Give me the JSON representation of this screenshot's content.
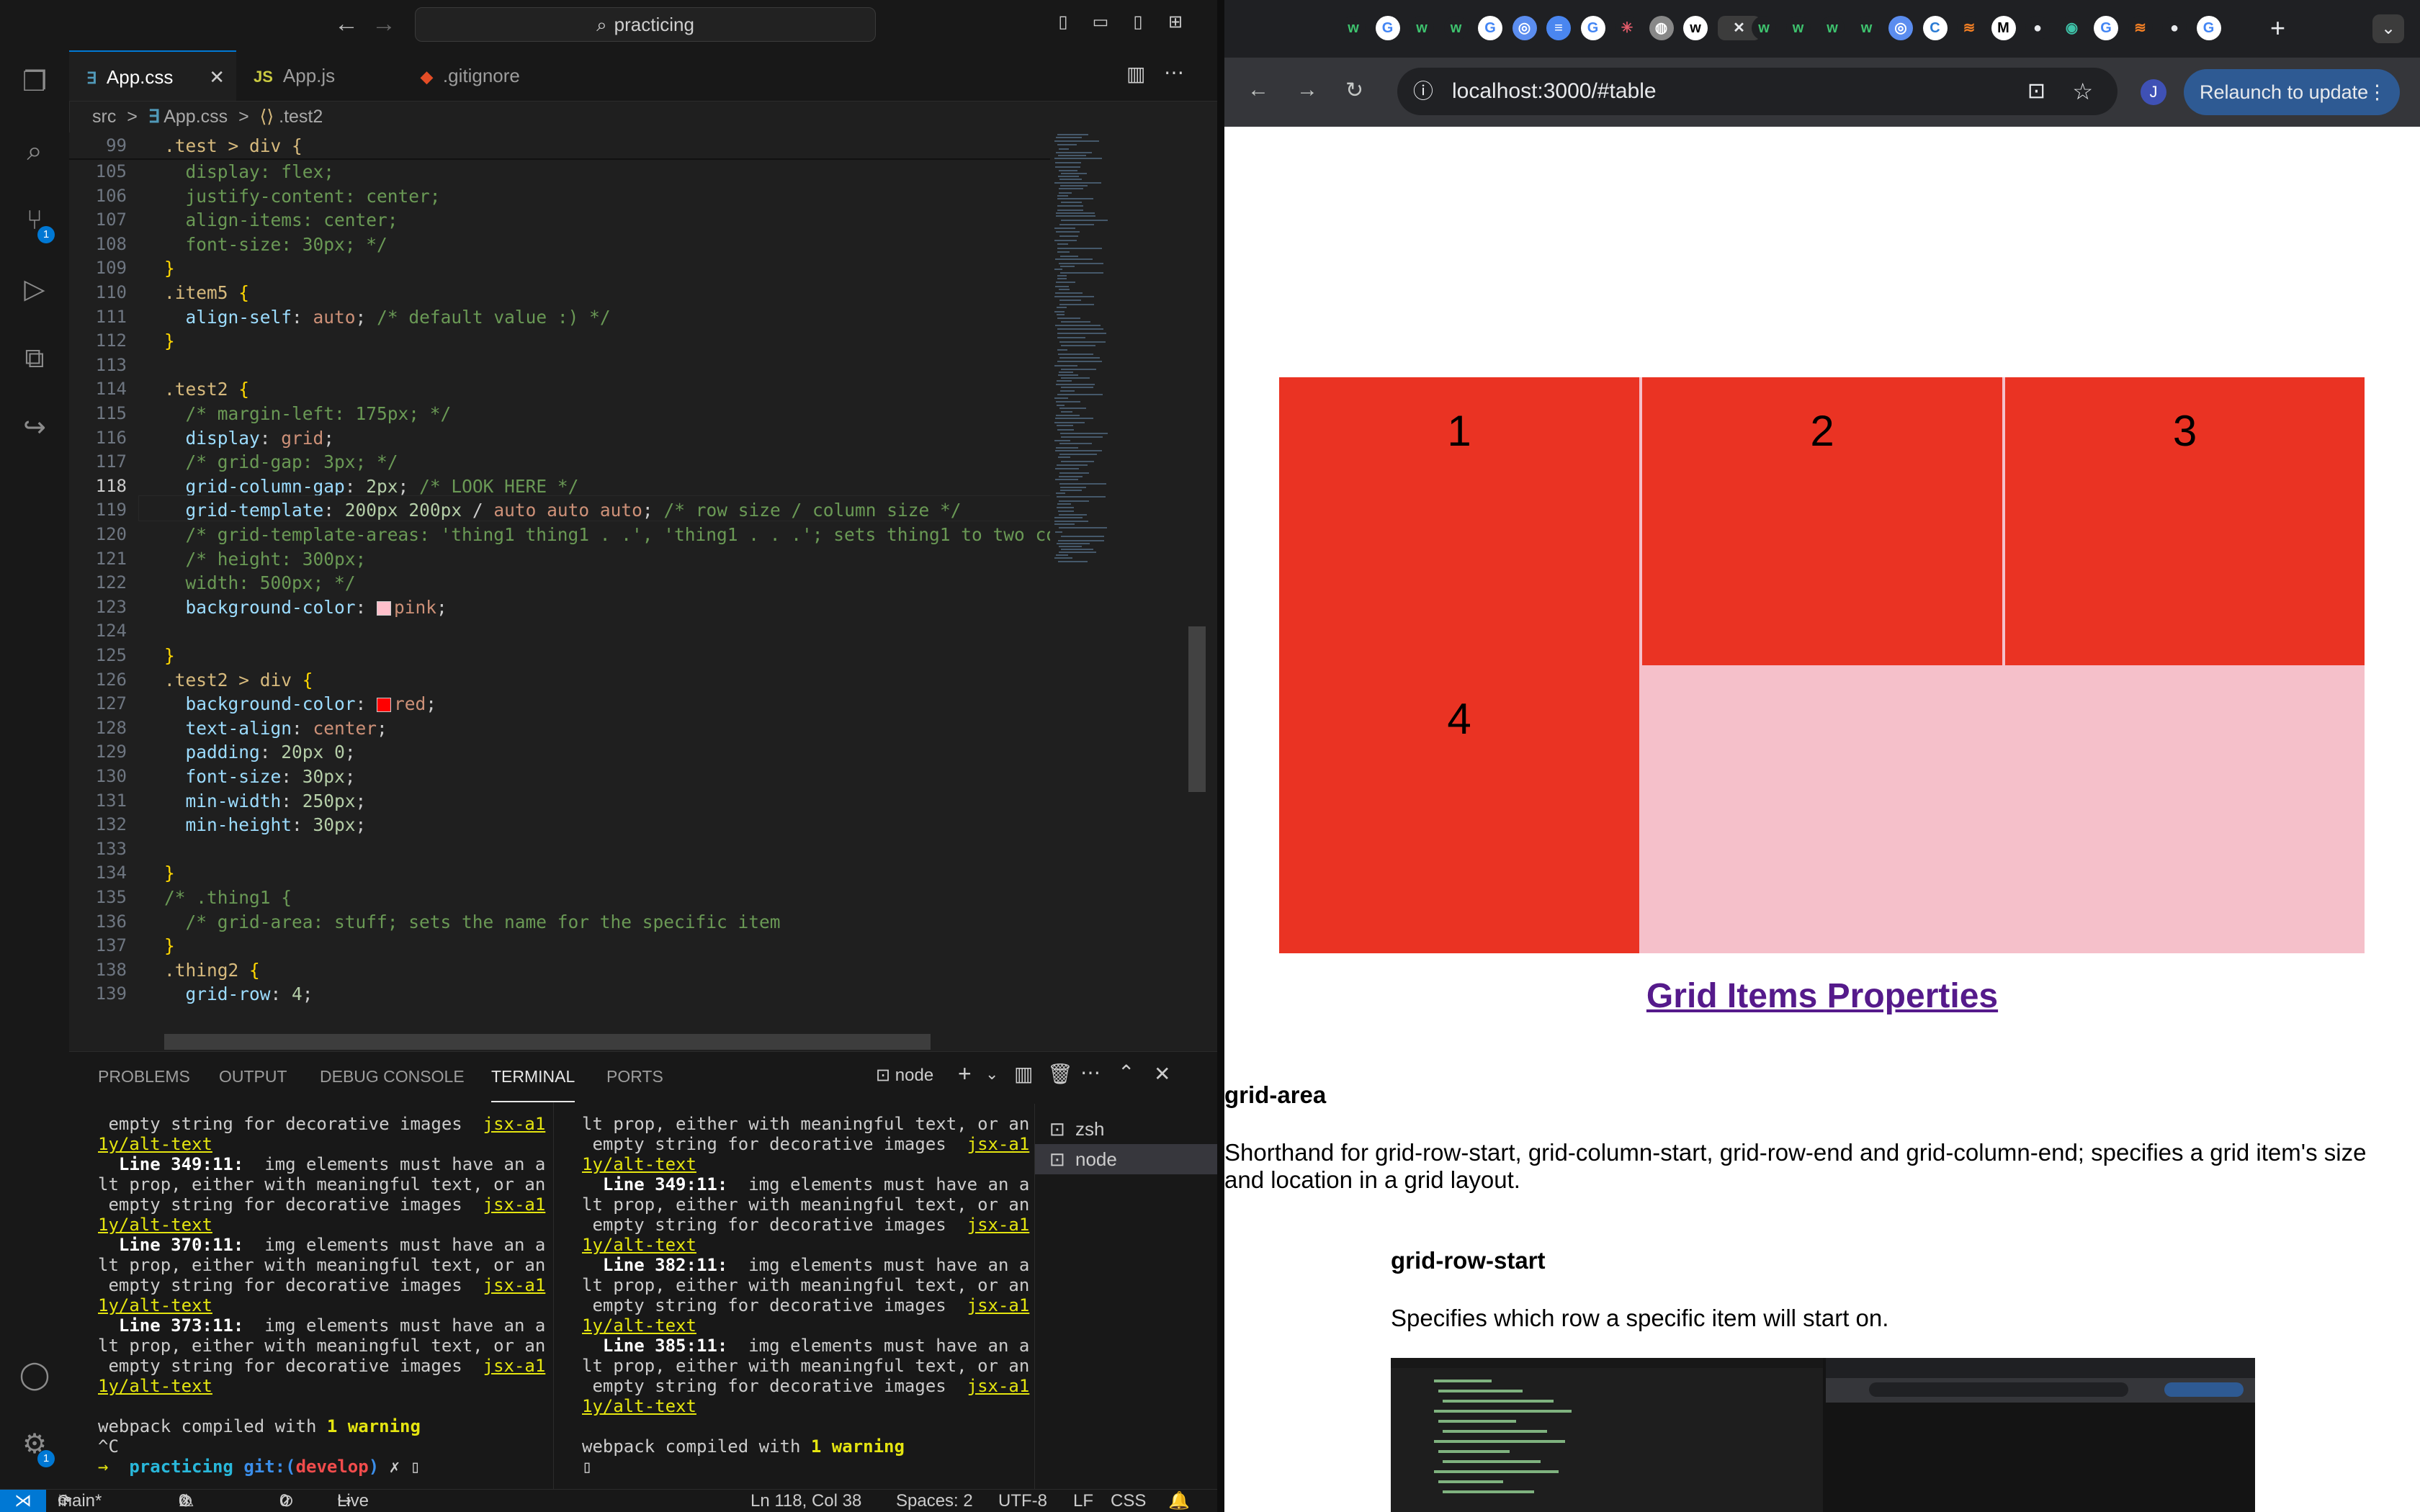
{
  "vscode": {
    "search_text": "practicing",
    "tabs": [
      {
        "icon": "css-icon",
        "label": "App.css",
        "active": true
      },
      {
        "icon": "js-icon",
        "label": "App.js",
        "active": false
      },
      {
        "icon": "git-icon",
        "label": ".gitignore",
        "active": false
      }
    ],
    "breadcrumb": [
      "src",
      "App.css",
      ".test2"
    ],
    "sticky_line": {
      "num": "99",
      "text": ".test > div {"
    },
    "line_numbers": [
      "105",
      "106",
      "107",
      "108",
      "109",
      "110",
      "111",
      "112",
      "113",
      "114",
      "115",
      "116",
      "117",
      "118",
      "119",
      "120",
      "121",
      "122",
      "123",
      "124",
      "125",
      "126",
      "127",
      "128",
      "129",
      "130",
      "131",
      "132",
      "133",
      "134",
      "135",
      "136",
      "137",
      "138",
      "139"
    ],
    "code_lines": [
      "  display: flex;",
      "  justify-content: center;",
      "  align-items: center;",
      "  font-size: 30px; */",
      "}",
      ".item5 {",
      "  align-self: auto; /* default value :) */",
      "}",
      "",
      ".test2 {",
      "  /* margin-left: 175px; */",
      "  display: grid;",
      "  /* grid-gap: 3px; */",
      "  grid-column-gap: 2px; /* LOOK HERE */",
      "  grid-template: 200px 200px / auto auto auto; /* row size / column size */",
      "  /* grid-template-areas: 'thing1 thing1 . .', 'thing1 . . .'; sets thing1 to two col",
      "  /* height: 300px;",
      "  width: 500px; */",
      "  background-color: pink;",
      "",
      "}",
      ".test2 > div {",
      "  background-color: red;",
      "  text-align: center;",
      "  padding: 20px 0;",
      "  font-size: 30px;",
      "  min-width: 250px;",
      "  min-height: 30px;",
      "",
      "}",
      "/* .thing1 {",
      "  /* grid-area: stuff; sets the name for the specific item",
      "}",
      ".thing2 {",
      "  grid-row: 4;"
    ],
    "current_line": "118",
    "panel_tabs": [
      "PROBLEMS",
      "OUTPUT",
      "DEBUG CONSOLE",
      "TERMINAL",
      "PORTS"
    ],
    "active_panel_tab": "TERMINAL",
    "terminal_name": "node",
    "terminal_left": [
      " empty string for decorative images  jsx-a1",
      "1y/alt-text",
      "  Line 349:11:  img elements must have an a",
      "lt prop, either with meaningful text, or an",
      " empty string for decorative images  jsx-a1",
      "1y/alt-text",
      "  Line 370:11:  img elements must have an a",
      "lt prop, either with meaningful text, or an",
      " empty string for decorative images  jsx-a1",
      "1y/alt-text",
      "  Line 373:11:  img elements must have an a",
      "lt prop, either with meaningful text, or an",
      " empty string for decorative images  jsx-a1",
      "1y/alt-text",
      "",
      "webpack compiled with 1 warning",
      "^C",
      "→  practicing git:(develop) ✗ ▯"
    ],
    "terminal_right": [
      "lt prop, either with meaningful text, or an",
      " empty string for decorative images  jsx-a1",
      "1y/alt-text",
      "  Line 349:11:  img elements must have an a",
      "lt prop, either with meaningful text, or an",
      " empty string for decorative images  jsx-a1",
      "1y/alt-text",
      "  Line 382:11:  img elements must have an a",
      "lt prop, either with meaningful text, or an",
      " empty string for decorative images  jsx-a1",
      "1y/alt-text",
      "  Line 385:11:  img elements must have an a",
      "lt prop, either with meaningful text, or an",
      " empty string for decorative images  jsx-a1",
      "1y/alt-text",
      "",
      "webpack compiled with 1 warning",
      "▯"
    ],
    "terminals": [
      "zsh",
      "node"
    ],
    "status": {
      "branch": "main*",
      "errors": "0",
      "warnings": "0",
      "ports": "0",
      "live_share": "Live Share",
      "position": "Ln 118, Col 38",
      "spaces": "Spaces: 2",
      "encoding": "UTF-8",
      "eol": "LF",
      "language": "CSS"
    },
    "source_control_badge": "1",
    "settings_badge": "1"
  },
  "chrome": {
    "url": "localhost:3000/#table",
    "relaunch_label": "Relaunch to update",
    "profile_initial": "J",
    "page": {
      "grid_cells": [
        "1",
        "2",
        "3",
        "4"
      ],
      "section_title": "Grid Items Properties",
      "h_grid_area": "grid-area",
      "p_grid_area": "Shorthand for grid-row-start, grid-column-start, grid-row-end and grid-column-end; specifies a grid item's size and location in a grid layout.",
      "h_grid_row_start": "grid-row-start",
      "p_grid_row_start": "Specifies which row a specific item will start on."
    }
  },
  "colors": {
    "accent": "#0078d4",
    "grid_red": "#ea3323",
    "grid_pink": "#f5c0ca",
    "link": "#551a8b"
  }
}
